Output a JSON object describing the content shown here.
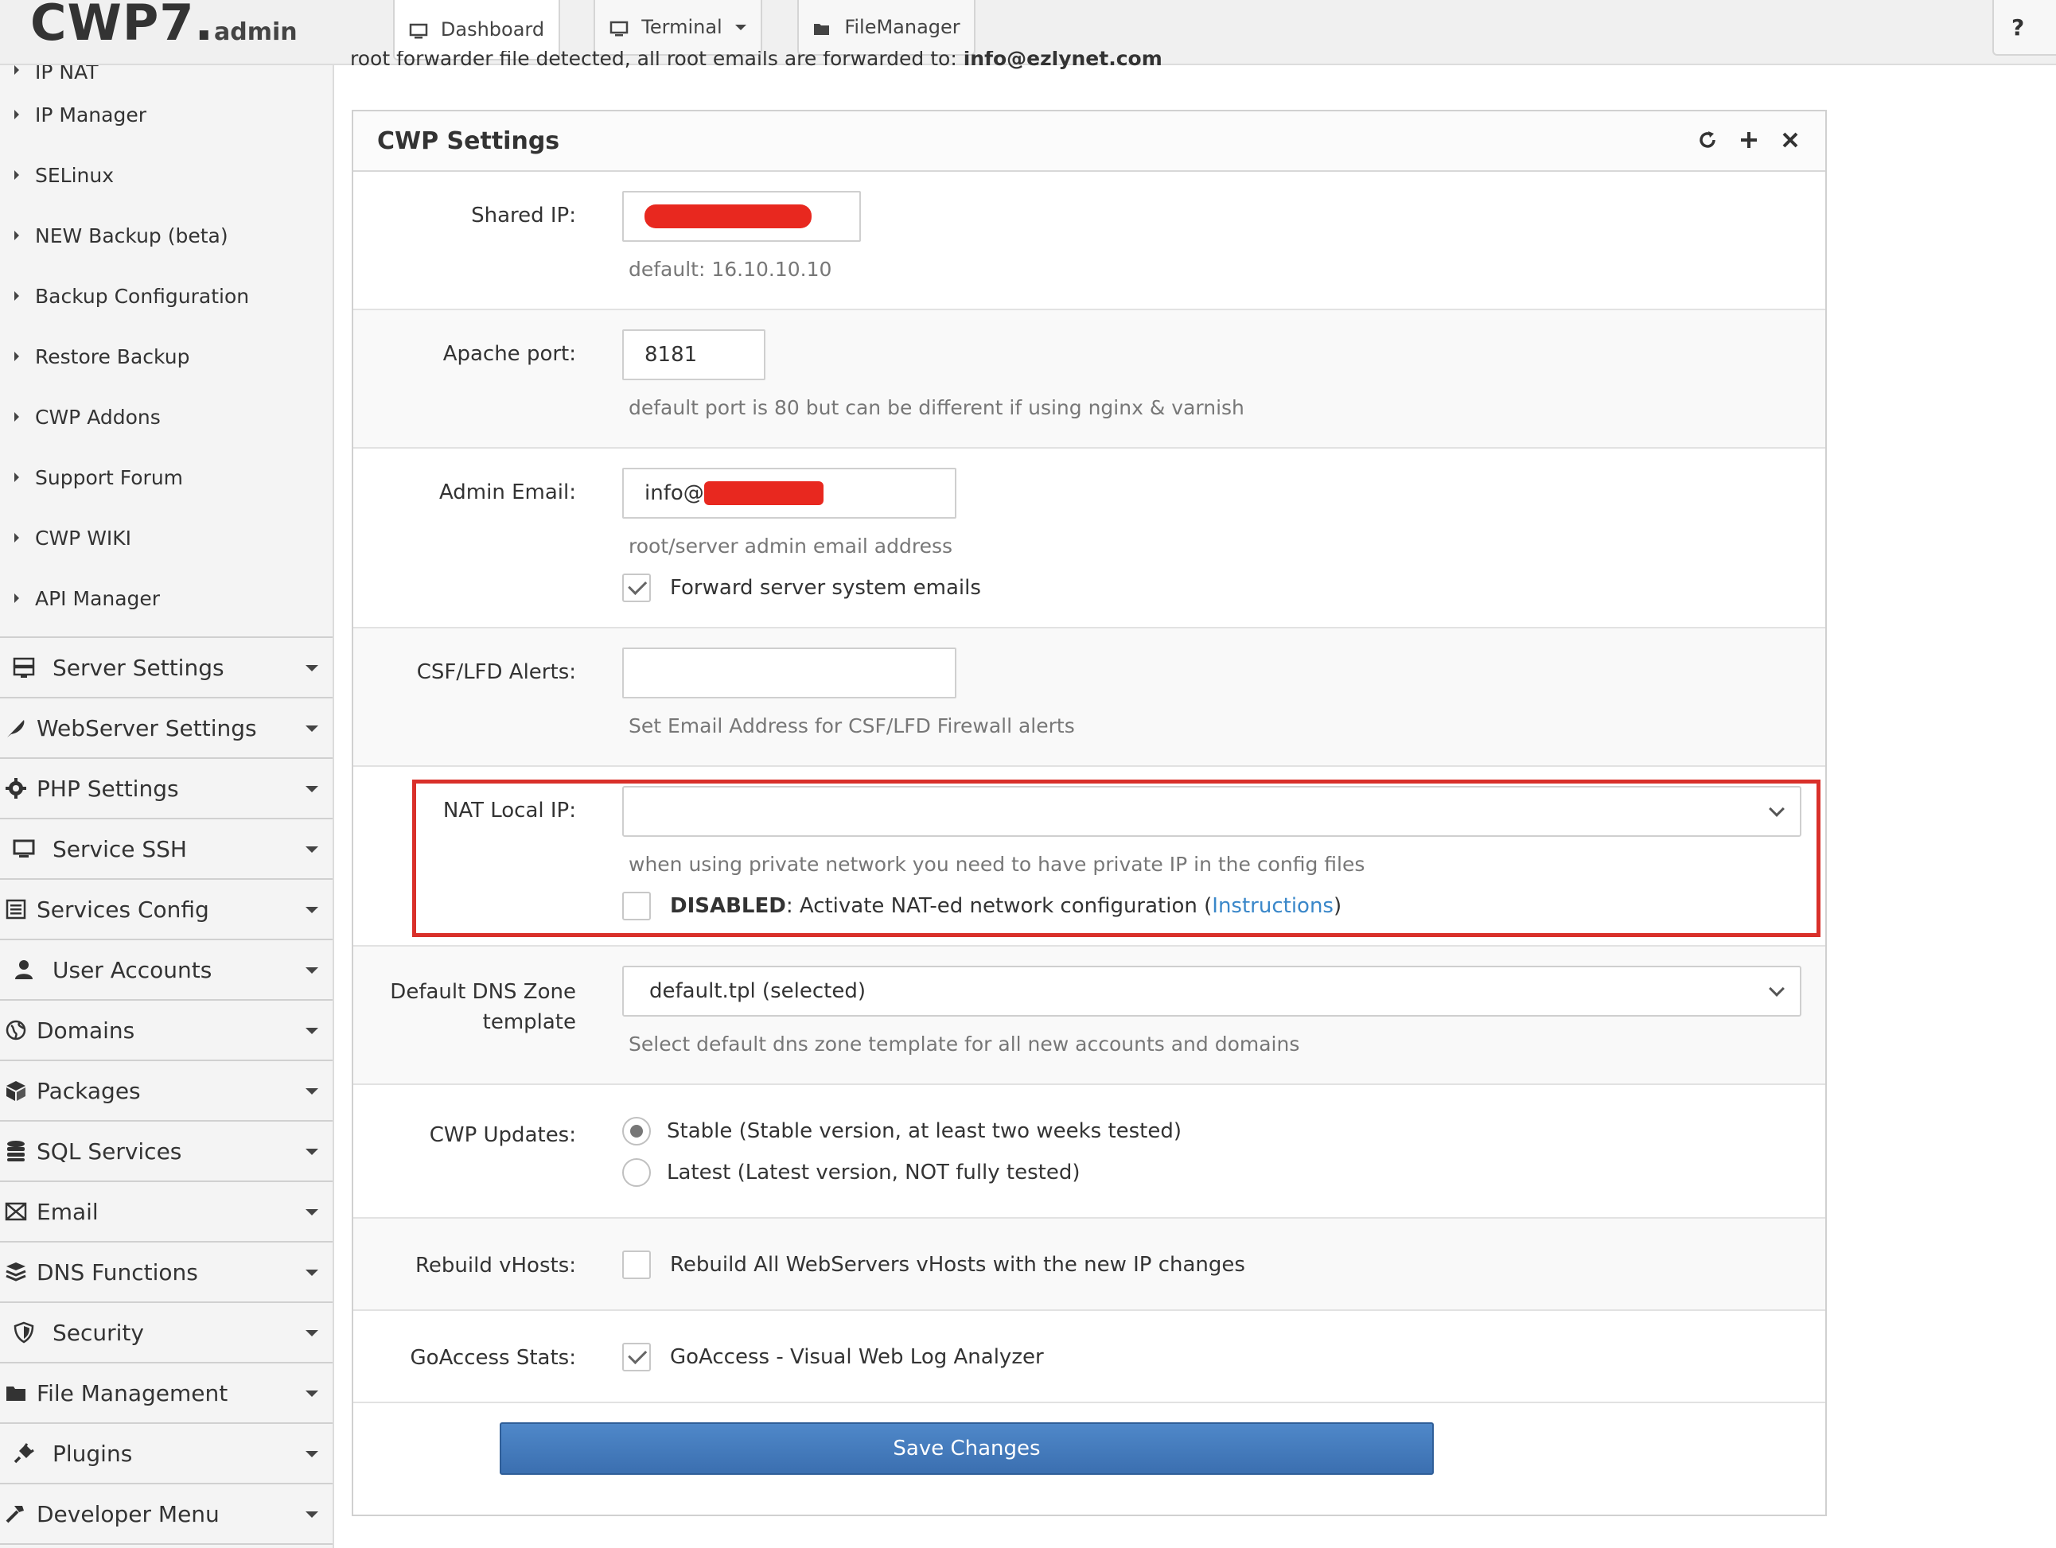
{
  "header": {
    "logo_main": "CWP7",
    "logo_dot": ".",
    "logo_suffix": "admin",
    "tabs": [
      {
        "label": "Dashboard"
      },
      {
        "label": "Terminal"
      },
      {
        "label": "FileManager"
      }
    ],
    "help_label": "?"
  },
  "sidebar": {
    "sub_items": [
      {
        "label": "IP NAT"
      },
      {
        "label": "IP Manager"
      },
      {
        "label": "SELinux"
      },
      {
        "label": "NEW Backup (beta)"
      },
      {
        "label": "Backup Configuration"
      },
      {
        "label": "Restore Backup"
      },
      {
        "label": "CWP Addons"
      },
      {
        "label": "Support Forum"
      },
      {
        "label": "CWP WIKI"
      },
      {
        "label": "API Manager"
      }
    ],
    "menu": [
      {
        "label": "Server Settings",
        "icon": "server-icon"
      },
      {
        "label": "WebServer Settings",
        "icon": "feather-icon"
      },
      {
        "label": "PHP Settings",
        "icon": "gear-icon"
      },
      {
        "label": "Service SSH",
        "icon": "monitor-icon"
      },
      {
        "label": "Services Config",
        "icon": "list-icon"
      },
      {
        "label": "User Accounts",
        "icon": "user-icon"
      },
      {
        "label": "Domains",
        "icon": "globe-icon"
      },
      {
        "label": "Packages",
        "icon": "cubes-icon"
      },
      {
        "label": "SQL Services",
        "icon": "database-icon"
      },
      {
        "label": "Email",
        "icon": "envelope-icon"
      },
      {
        "label": "DNS Functions",
        "icon": "layers-icon"
      },
      {
        "label": "Security",
        "icon": "shield-icon"
      },
      {
        "label": "File Management",
        "icon": "folder-icon"
      },
      {
        "label": "Plugins",
        "icon": "plug-icon"
      },
      {
        "label": "Developer Menu",
        "icon": "hammer-icon"
      }
    ]
  },
  "notice": {
    "text": "root forwarder file detected, all root emails are forwarded to: ",
    "email": "info@ezlynet.com"
  },
  "panel": {
    "title": "CWP Settings",
    "shared_ip": {
      "label": "Shared IP:",
      "value": "",
      "help": "default: 16.10.10.10"
    },
    "apache_port": {
      "label": "Apache port:",
      "value": "8181",
      "help": "default port is 80 but can be different if using nginx & varnish"
    },
    "admin_email": {
      "label": "Admin Email:",
      "value_prefix": "info@",
      "help": "root/server admin email address",
      "forward_label": "Forward server system emails",
      "forward_checked": true
    },
    "csf_alerts": {
      "label": "CSF/LFD Alerts:",
      "value": "",
      "help": "Set Email Address for CSF/LFD Firewall alerts"
    },
    "nat_local_ip": {
      "label": "NAT Local IP:",
      "value": "",
      "help": "when using private network you need to have private IP in the config files",
      "status_bold": "DISABLED",
      "status_text": ": Activate NAT-ed network configuration ( ",
      "link": "Instructions",
      "status_end": " )",
      "checked": false
    },
    "dns_template": {
      "label_line1": "Default DNS Zone",
      "label_line2": "template",
      "value": "default.tpl (selected)",
      "help": "Select default dns zone template for all new accounts and domains"
    },
    "cwp_updates": {
      "label": "CWP Updates:",
      "option_stable": "Stable (Stable version, at least two weeks tested)",
      "option_latest": "Latest (Latest version, NOT fully tested)",
      "selected": "stable"
    },
    "rebuild_vhosts": {
      "label": "Rebuild vHosts:",
      "text": "Rebuild All WebServers vHosts with the new IP changes",
      "checked": false
    },
    "goaccess": {
      "label": "GoAccess Stats:",
      "text": "GoAccess - Visual Web Log Analyzer",
      "checked": true
    },
    "save_label": "Save Changes"
  },
  "colors": {
    "accent": "#3b6fb0",
    "highlight_border": "#d9302a",
    "redaction": "#e8281f",
    "link": "#3a87c9"
  }
}
